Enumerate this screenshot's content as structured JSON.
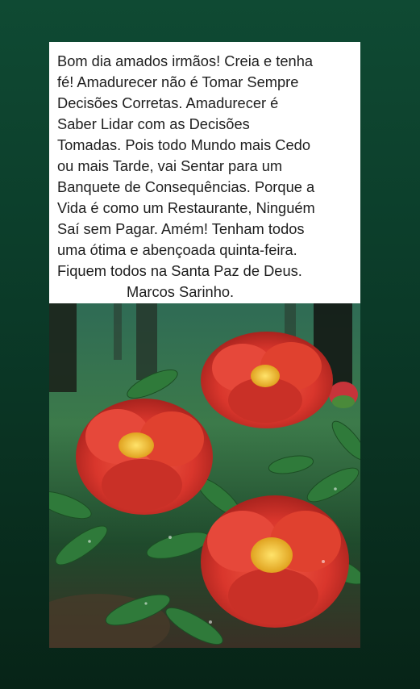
{
  "post": {
    "message_lines": [
      "Bom dia amados irmãos! Creia e tenha",
      "fé! Amadurecer não é Tomar Sempre",
      "Decisões Corretas. Amadurecer é",
      "Saber Lidar com as Decisões",
      "Tomadas. Pois todo Mundo mais Cedo",
      "ou mais Tarde, vai Sentar para um",
      "Banquete de Consequências. Porque a",
      "Vida é como um Restaurante, Ninguém",
      "Saí sem Pagar. Amém! Tenham todos",
      "uma ótima e abençoada quinta-feira.",
      "Fiquem todos na Santa Paz de Deus."
    ],
    "signature": "Marcos Sarinho."
  },
  "colors": {
    "background_top": "#0f4a33",
    "background_bottom": "#072417",
    "flower_red": "#d9362c",
    "flower_center": "#f2c12e",
    "leaf_green": "#2f7a3a"
  }
}
